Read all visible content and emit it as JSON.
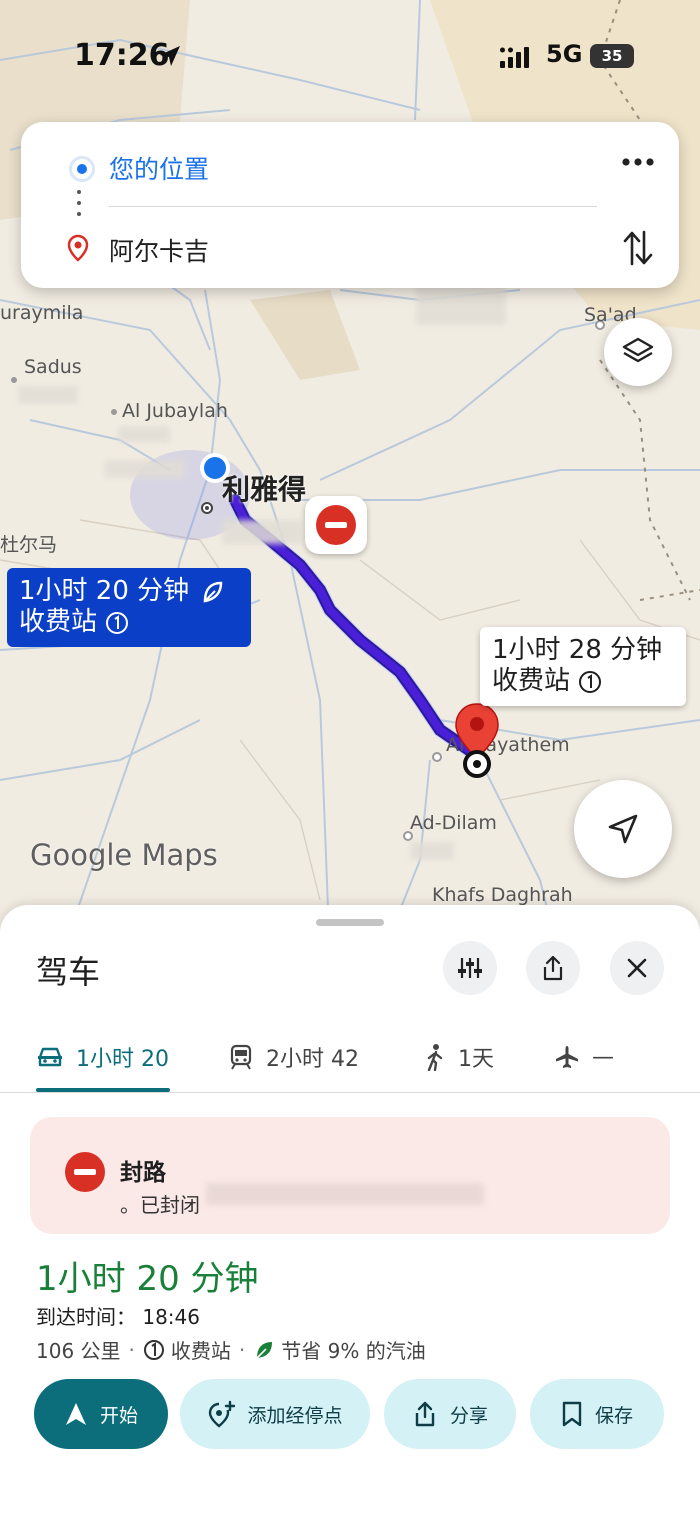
{
  "status_bar": {
    "time": "17:26",
    "network": "5G",
    "battery": "35"
  },
  "route_inputs": {
    "origin": "您的位置",
    "destination": "阿尔卡吉"
  },
  "map": {
    "city": "利雅得",
    "places": [
      "uraymila",
      "Sadus",
      "Al Jubaylah",
      "杜尔马",
      "Sa'ad",
      "Al-Hayathem",
      "Ad-Dilam",
      "Khafs Daghrah"
    ],
    "route_selected": {
      "line1": "1小时 20 分钟",
      "line2": "收费站"
    },
    "route_alternative": {
      "line1": "1小时 28 分钟",
      "line2": "收费站"
    },
    "logo": "Google Maps",
    "route_color": "#4a1fd8"
  },
  "sheet": {
    "title": "驾车",
    "tabs": [
      {
        "label": "1小时 20",
        "icon": "car-icon"
      },
      {
        "label": "2小时 42",
        "icon": "train-icon"
      },
      {
        "label": "1天",
        "icon": "walk-icon"
      },
      {
        "label": "—",
        "icon": "flight-icon"
      }
    ],
    "alert": {
      "title": "封路",
      "subtitle": "。已封闭"
    },
    "duration": "1小时 20 分钟",
    "arrival": "到达时间： 18:46",
    "distance": "106 公里",
    "toll": "收费站",
    "fuel": "节省 9% 的汽油",
    "actions": {
      "start": "开始",
      "add_stop": "添加经停点",
      "share": "分享",
      "save": "保存"
    },
    "accent": "#0b6e7a",
    "duration_color": "#188038"
  }
}
